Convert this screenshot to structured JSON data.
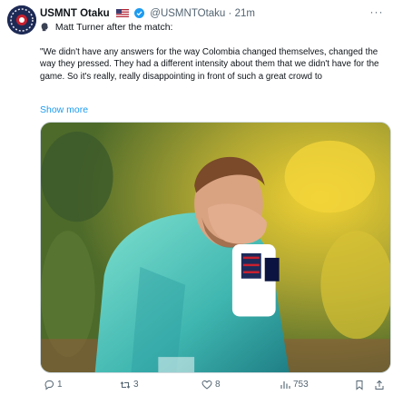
{
  "tweet": {
    "author_name": "USMNT Otaku",
    "handle": "@USMNTOtaku",
    "separator": "·",
    "time": "21m",
    "more_label": "···",
    "subline": "Matt Turner after the match:",
    "quote": "\"We didn't have any answers for the way Colombia changed themselves, changed the way they pressed. They had a different intensity about them that we didn't have for the game. So it's really, really disappointing in front of such a great crowd to",
    "show_more": "Show more"
  },
  "actions": {
    "replies": "1",
    "reposts": "3",
    "likes": "8",
    "views": "753"
  },
  "colors": {
    "link": "#1d9bf0",
    "muted": "#536471",
    "verified": "#1d9bf0"
  },
  "icons": [
    "usa-flag-icon",
    "verified-badge-icon",
    "speaking-head-icon",
    "more-icon",
    "reply-icon",
    "repost-icon",
    "like-icon",
    "views-icon",
    "bookmark-icon",
    "share-icon"
  ]
}
